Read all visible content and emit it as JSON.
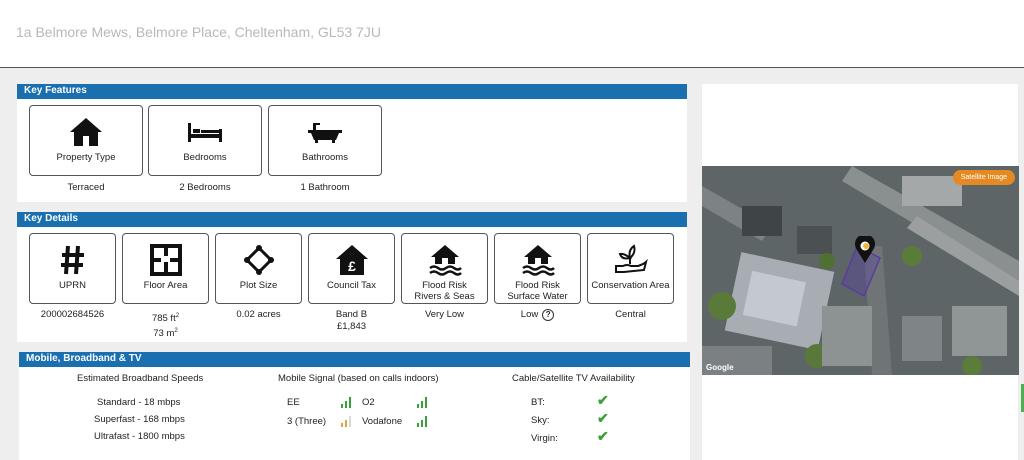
{
  "address": "1a Belmore Mews, Belmore Place, Cheltenham, GL53 7JU",
  "key_features": {
    "title": "Key Features",
    "cards": [
      {
        "label": "Property Type",
        "value": "Terraced",
        "icon": "house-icon"
      },
      {
        "label": "Bedrooms",
        "value": "2 Bedrooms",
        "icon": "bed-icon"
      },
      {
        "label": "Bathrooms",
        "value": "1 Bathroom",
        "icon": "bath-icon"
      }
    ]
  },
  "key_details": {
    "title": "Key Details",
    "cards": [
      {
        "label": "UPRN",
        "value": "200002684526",
        "icon": "hash-icon"
      },
      {
        "label": "Floor Area",
        "value_ft": "785 ft",
        "value_m": "73 m",
        "sup": "2",
        "icon": "floor-plan-icon"
      },
      {
        "label": "Plot Size",
        "value": "0.02 acres",
        "icon": "plot-icon"
      },
      {
        "label": "Council Tax",
        "value": "Band B",
        "value2": "£1,843",
        "icon": "council-tax-icon"
      },
      {
        "label": "Flood Risk",
        "label2": "Rivers & Seas",
        "value": "Very Low",
        "icon": "flood-rivers-icon"
      },
      {
        "label": "Flood Risk",
        "label2": "Surface Water",
        "value": "Low",
        "help": "?",
        "icon": "flood-surface-icon"
      },
      {
        "label": "Conservation Area",
        "value": "Central",
        "icon": "conservation-icon"
      }
    ]
  },
  "mobile": {
    "title": "Mobile, Broadband & TV",
    "broadband_heading": "Estimated Broadband Speeds",
    "broadband": [
      "Standard - 18 mbps",
      "Superfast - 168 mbps",
      "Ultrafast - 1800 mbps"
    ],
    "signal_heading": "Mobile Signal (based on calls indoors)",
    "networks": [
      {
        "name": "EE",
        "color": "#3aa03a"
      },
      {
        "name": "O2",
        "color": "#3aa03a"
      },
      {
        "name": "3 (Three)",
        "color": "#e8a23a"
      },
      {
        "name": "Vodafone",
        "color": "#3aa03a"
      }
    ],
    "tv_heading": "Cable/Satellite TV Availability",
    "tv": [
      "BT:",
      "Sky:",
      "Virgin:"
    ]
  },
  "map": {
    "satellite_label": "Satellite Image",
    "google_label": "Google"
  }
}
